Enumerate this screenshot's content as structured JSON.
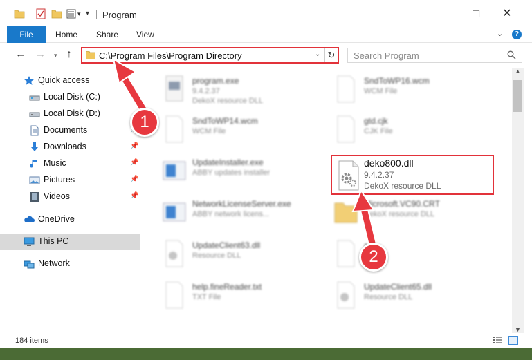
{
  "window": {
    "title": "Program",
    "controls": {
      "minimize": "—",
      "maximize": "☐",
      "close": "✕"
    }
  },
  "ribbon": {
    "tabs": [
      "File",
      "Home",
      "Share",
      "View"
    ]
  },
  "address_bar": {
    "path": "C:\\Program Files\\Program Directory"
  },
  "search": {
    "placeholder": "Search Program"
  },
  "sidebar": {
    "items": [
      {
        "label": "Quick access",
        "icon": "star-icon",
        "pinned": false
      },
      {
        "label": "Local Disk (C:)",
        "icon": "drive-icon",
        "pinned": false
      },
      {
        "label": "Local Disk (D:)",
        "icon": "drive-icon",
        "pinned": false
      },
      {
        "label": "Documents",
        "icon": "documents-icon",
        "pinned": true
      },
      {
        "label": "Downloads",
        "icon": "download-icon",
        "pinned": true
      },
      {
        "label": "Music",
        "icon": "music-icon",
        "pinned": true
      },
      {
        "label": "Pictures",
        "icon": "pictures-icon",
        "pinned": true
      },
      {
        "label": "Videos",
        "icon": "videos-icon",
        "pinned": true
      },
      {
        "label": "OneDrive",
        "icon": "cloud-icon",
        "pinned": false
      },
      {
        "label": "This PC",
        "icon": "computer-icon",
        "pinned": false,
        "selected": true
      },
      {
        "label": "Network",
        "icon": "network-icon",
        "pinned": false
      }
    ]
  },
  "files": [
    {
      "name": "program.exe",
      "version": "9.4.2.37",
      "desc": "DekoX resource DLL",
      "type": "exe"
    },
    {
      "name": "SndToWP16.wcm",
      "version": "",
      "desc": "WCM File",
      "type": "doc"
    },
    {
      "name": "SndToWP14.wcm",
      "version": "",
      "desc": "WCM File",
      "type": "doc"
    },
    {
      "name": "gtd.cjk",
      "version": "",
      "desc": "CJK File",
      "type": "doc"
    },
    {
      "name": "UpdateInstaller.exe",
      "version": "",
      "desc": "ABBY updates installer",
      "type": "app"
    },
    {
      "name": "NetworkLicenseServer.exe",
      "version": "",
      "desc": "ABBY network licens...",
      "type": "app"
    },
    {
      "name": "Microsoft.VC90.CRT",
      "version": "",
      "desc": "DekoX resource DLL",
      "type": "folder"
    },
    {
      "name": "UpdateClient63.dll",
      "version": "",
      "desc": "Resource DLL",
      "type": "dll"
    },
    {
      "name": "ask",
      "version": "",
      "desc": "",
      "type": "doc"
    },
    {
      "name": "help.fineReader.txt",
      "version": "",
      "desc": "TXT File",
      "type": "doc"
    },
    {
      "name": "UpdateClient65.dll",
      "version": "",
      "desc": "Resource DLL",
      "type": "dll"
    }
  ],
  "highlighted_file": {
    "name": "deko800.dll",
    "version": "9.4.2.37",
    "desc": "DekoX resource DLL"
  },
  "callouts": {
    "one": "1",
    "two": "2"
  },
  "status": {
    "count": "184 items"
  },
  "colors": {
    "accent": "#1979ca",
    "highlight": "#e2323a",
    "selected_nav": "#d9d9d9"
  }
}
